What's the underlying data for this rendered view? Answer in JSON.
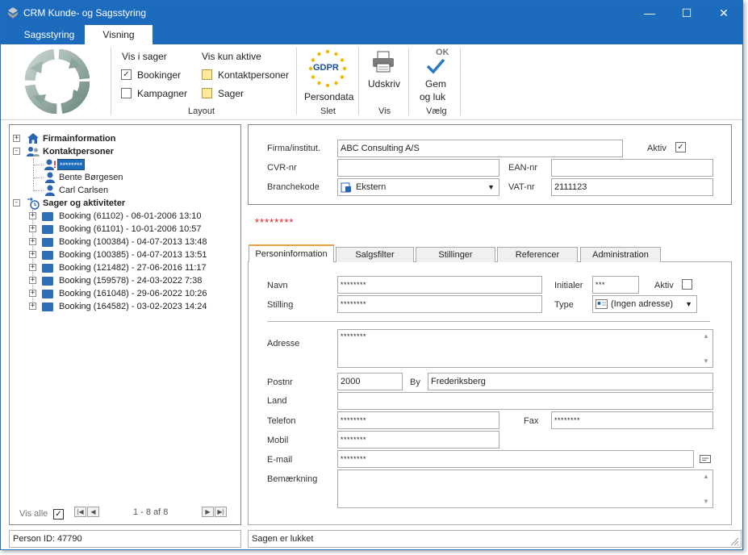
{
  "window": {
    "title": "CRM Kunde- og Sagsstyring",
    "minimize": "—",
    "maximize": "☐",
    "close": "✕"
  },
  "ribbon_tabs": [
    {
      "label": "Sagsstyring"
    },
    {
      "label": "Visning"
    }
  ],
  "ribbon": {
    "vis_i_sager": "Vis i sager",
    "bookinger": "Bookinger",
    "bookinger_checked": "✓",
    "kampagner": "Kampagner",
    "vis_kun_aktive": "Vis kun aktive",
    "kontaktpersoner": "Kontaktpersoner",
    "sager": "Sager",
    "layout_label": "Layout",
    "gdpr_badge": "GDPR",
    "persondata": "Persondata",
    "slet_label": "Slet",
    "udskriv": "Udskriv",
    "vis_label": "Vis",
    "ok_badge": "OK",
    "gem_line1": "Gem",
    "gem_line2": "og  luk",
    "vaelg_label": "Vælg"
  },
  "tree": {
    "firmainformation": "Firmainformation",
    "kontaktpersoner": "Kontaktpersoner",
    "persons": [
      {
        "name": "********"
      },
      {
        "name": "Bente Børgesen"
      },
      {
        "name": "Carl Carlsen"
      }
    ],
    "sager": "Sager og aktiviteter",
    "bookings": [
      {
        "label": "Booking (61102) - 06-01-2006  13:10"
      },
      {
        "label": "Booking (61101) - 10-01-2006  10:57"
      },
      {
        "label": "Booking (100384) - 04-07-2013  13:48"
      },
      {
        "label": "Booking (100385) - 04-07-2013  13:51"
      },
      {
        "label": "Booking (121482) - 27-06-2016  11:17"
      },
      {
        "label": "Booking (159578) - 24-03-2022  7:38"
      },
      {
        "label": "Booking (161048) - 29-06-2022  10:26"
      },
      {
        "label": "Booking (164582) - 03-02-2023  14:24"
      }
    ],
    "vis_alle": "Vis alle",
    "vis_alle_checked": "✓",
    "pager": "1 - 8 af 8"
  },
  "company": {
    "firma_label": "Firma/institut.",
    "firma_value": "ABC Consulting A/S",
    "aktiv_label": "Aktiv",
    "aktiv_checked": "✓",
    "cvr_label": "CVR-nr",
    "cvr_value": "",
    "ean_label": "EAN-nr",
    "ean_value": "",
    "branche_label": "Branchekode",
    "branche_value": "Ekstern",
    "vat_label": "VAT-nr",
    "vat_value": "2111123"
  },
  "person_title": "********",
  "person_tabs": [
    {
      "label": "Personinformation"
    },
    {
      "label": "Salgsfilter"
    },
    {
      "label": "Stillinger"
    },
    {
      "label": "Referencer"
    },
    {
      "label": "Administration"
    }
  ],
  "person": {
    "navn_label": "Navn",
    "navn_value": "********",
    "initialer_label": "Initialer",
    "initialer_value": "***",
    "aktiv_label": "Aktiv",
    "stilling_label": "Stilling",
    "stilling_value": "********",
    "type_label": "Type",
    "type_value": "(Ingen adresse)",
    "adresse_label": "Adresse",
    "adresse_value": "********",
    "postnr_label": "Postnr",
    "postnr_value": "2000",
    "by_label": "By",
    "by_value": "Frederiksberg",
    "land_label": "Land",
    "land_value": "",
    "telefon_label": "Telefon",
    "telefon_value": "********",
    "fax_label": "Fax",
    "fax_value": "********",
    "mobil_label": "Mobil",
    "mobil_value": "********",
    "email_label": "E-mail",
    "email_value": "********",
    "bemaerkning_label": "Bemærkning",
    "bemaerkning_value": ""
  },
  "status": {
    "person_id": "Person ID: 47790",
    "sag_status": "Sagen er lukket"
  },
  "colors": {
    "accent": "#1c6bbd",
    "red_text": "#e0141e",
    "tab_highlight": "#e8a040"
  }
}
